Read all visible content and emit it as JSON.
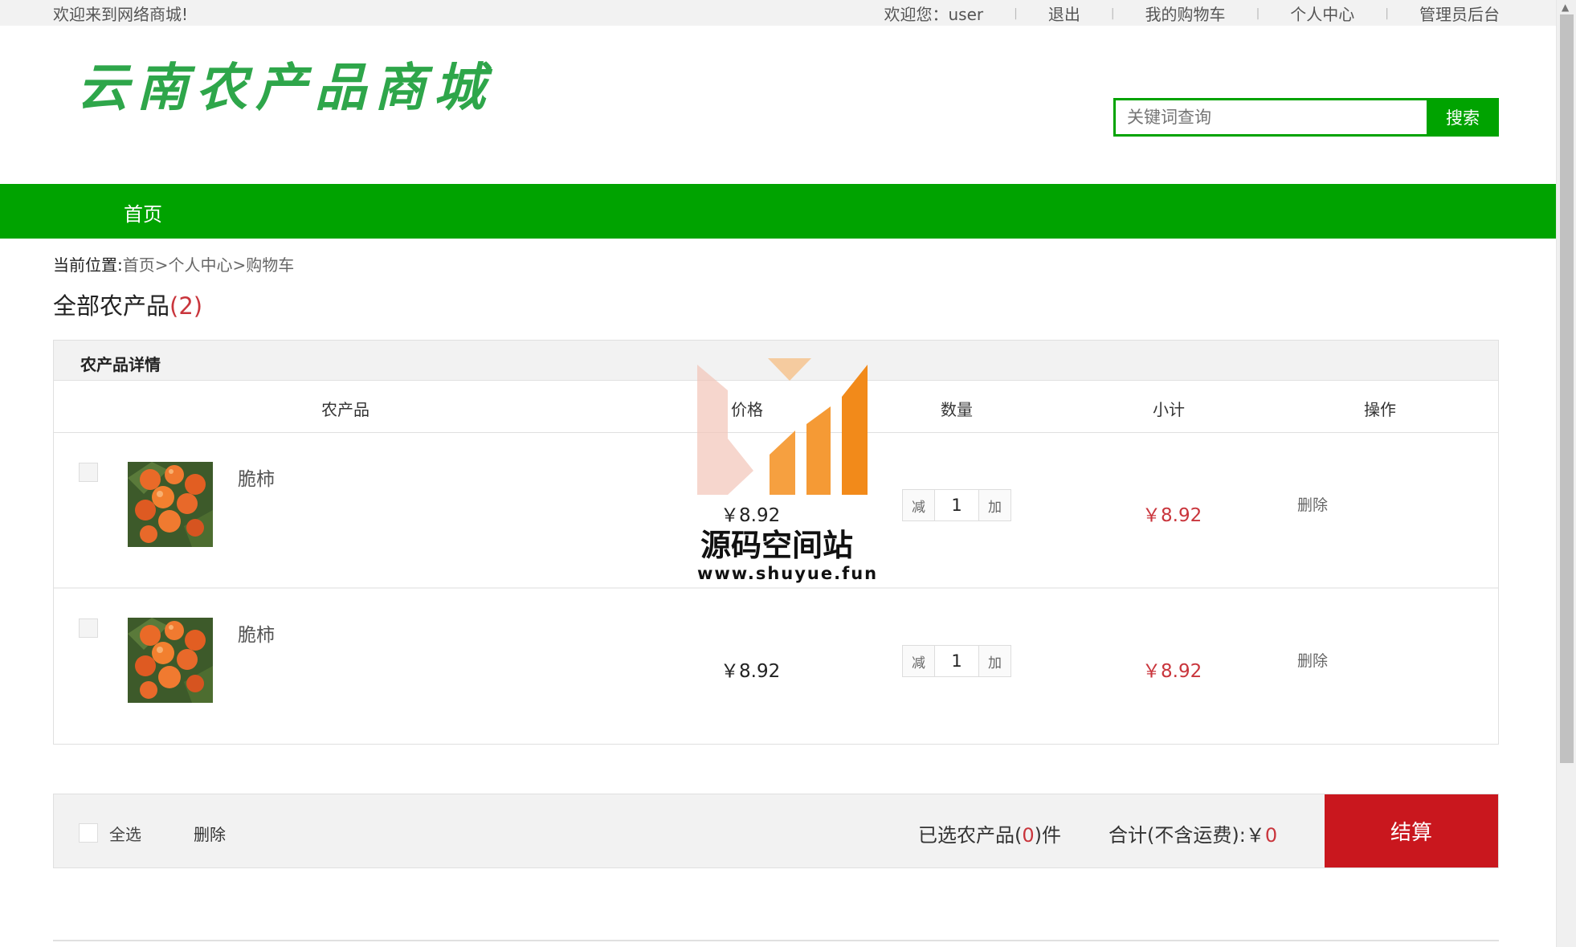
{
  "topbar": {
    "welcome": "欢迎来到网络商城!",
    "greeting": "欢迎您：user",
    "logout": "退出",
    "my_cart": "我的购物车",
    "personal_center": "个人中心",
    "admin": "管理员后台"
  },
  "logo": {
    "text": "云南农产品商城",
    "color": "#2ea64a"
  },
  "search": {
    "placeholder": "关键词查询",
    "button": "搜索"
  },
  "nav": {
    "home": "首页",
    "color": "#00a300"
  },
  "breadcrumb": {
    "label": "当前位置:",
    "path": "首页>个人中心>购物车"
  },
  "section": {
    "title": "全部农产品",
    "count": "(2)"
  },
  "cart": {
    "header": "农产品详情",
    "columns": {
      "product": "农产品",
      "price": "价格",
      "quantity": "数量",
      "subtotal": "小计",
      "action": "操作"
    },
    "items": [
      {
        "name": "脆柿",
        "price": "￥8.92",
        "minus": "减",
        "quantity": "1",
        "plus": "加",
        "subtotal": "￥8.92",
        "delete": "删除"
      },
      {
        "name": "脆柿",
        "price": "￥8.92",
        "minus": "减",
        "quantity": "1",
        "plus": "加",
        "subtotal": "￥8.92",
        "delete": "删除"
      }
    ]
  },
  "footer": {
    "select_all": "全选",
    "delete": "删除",
    "selected_prefix": "已选农产品(",
    "selected_count": "0",
    "selected_suffix": ")件",
    "total_label": "合计(不含运费):￥",
    "total_value": "0",
    "checkout": "结算",
    "checkout_color": "#c9171e"
  },
  "watermark": {
    "title": "源码空间站",
    "url": "www.shuyue.fun"
  }
}
